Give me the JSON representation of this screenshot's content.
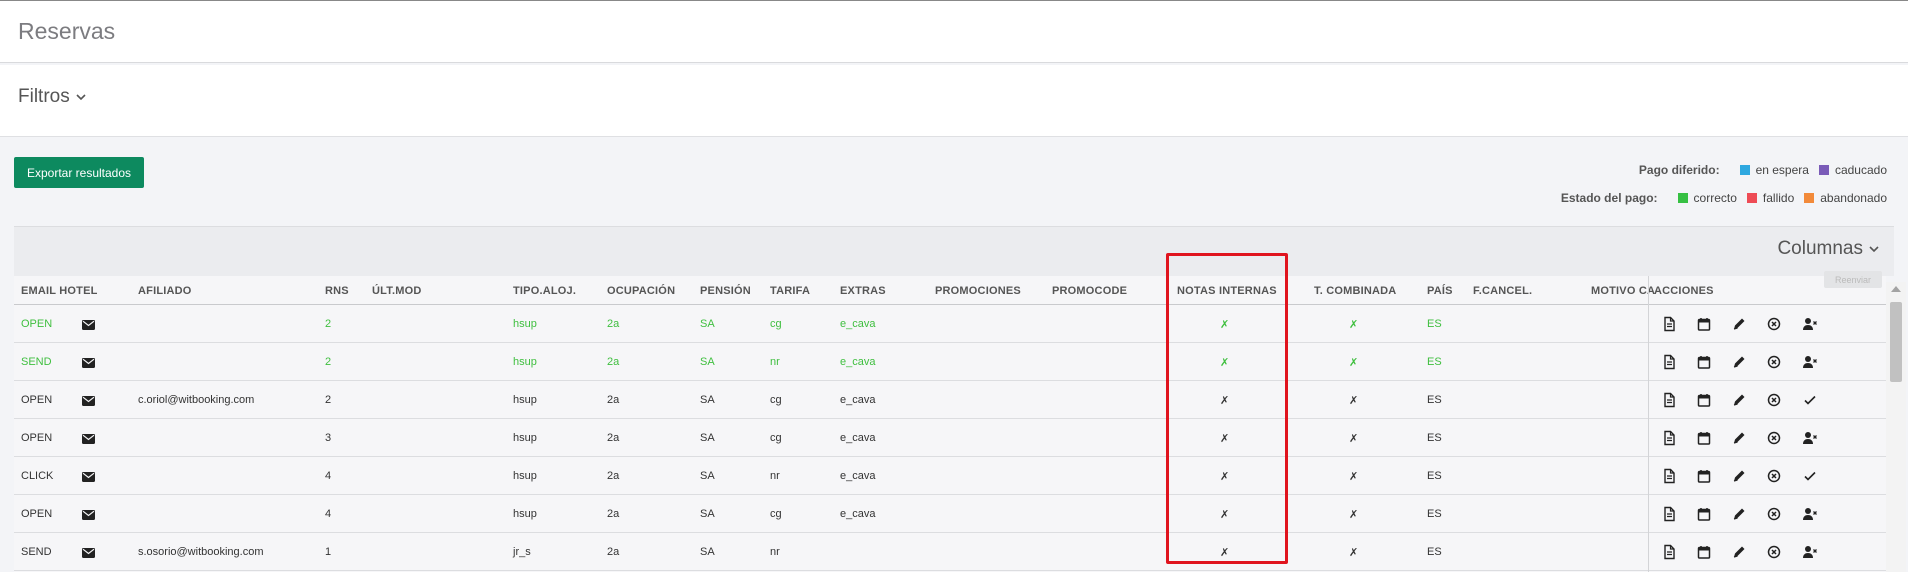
{
  "page": {
    "title": "Reservas"
  },
  "filters": {
    "label": "Filtros"
  },
  "toolbar": {
    "export_label": "Exportar resultados"
  },
  "legend": {
    "deferred_payment": {
      "title": "Pago diferido:",
      "items": [
        {
          "label": "en espera",
          "color": "#2ea8e0"
        },
        {
          "label": "caducado",
          "color": "#7a5bb8"
        }
      ]
    },
    "payment_status": {
      "title": "Estado del pago:",
      "items": [
        {
          "label": "correcto",
          "color": "#36c043"
        },
        {
          "label": "fallido",
          "color": "#ee4b55"
        },
        {
          "label": "abandonado",
          "color": "#f28a3a"
        }
      ]
    }
  },
  "columns_panel": {
    "label": "Columnas"
  },
  "tooltip": {
    "text": "Reenviar"
  },
  "table": {
    "headers": {
      "email": "EMAIL HOTEL",
      "afiliado": "AFILIADO",
      "rns": "RNS",
      "ultmod": "ÚLT.MOD",
      "tipo": "TIPO.ALOJ.",
      "ocupacion": "OCUPACIÓN",
      "pension": "PENSIÓN",
      "tarifa": "TARIFA",
      "extras": "EXTRAS",
      "promociones": "PROMOCIONES",
      "promocode": "PROMOCODE",
      "notas": "NOTAS INTERNAS",
      "combinada": "T. COMBINADA",
      "pais": "PAÍS",
      "fcancel": "F.CANCEL.",
      "motivo": "MOTIVO CA",
      "acciones": "ACCIONES"
    },
    "rows": [
      {
        "email_status": "OPEN",
        "afiliado": "",
        "rns": "2",
        "tipo": "hsup",
        "ocupacion": "2a",
        "pension": "SA",
        "tarifa": "cg",
        "extras": "e_cava",
        "notas": "✗",
        "combinada": "✗",
        "pais": "ES",
        "last_action": "user-remove-icon"
      },
      {
        "email_status": "SEND",
        "afiliado": "",
        "rns": "2",
        "tipo": "hsup",
        "ocupacion": "2a",
        "pension": "SA",
        "tarifa": "nr",
        "extras": "e_cava",
        "notas": "✗",
        "combinada": "✗",
        "pais": "ES",
        "last_action": "user-remove-icon"
      },
      {
        "email_status": "OPEN",
        "afiliado": "c.oriol@witbooking.com",
        "rns": "2",
        "tipo": "hsup",
        "ocupacion": "2a",
        "pension": "SA",
        "tarifa": "cg",
        "extras": "e_cava",
        "notas": "✗",
        "combinada": "✗",
        "pais": "ES",
        "last_action": "check-icon"
      },
      {
        "email_status": "OPEN",
        "afiliado": "",
        "rns": "3",
        "tipo": "hsup",
        "ocupacion": "2a",
        "pension": "SA",
        "tarifa": "cg",
        "extras": "e_cava",
        "notas": "✗",
        "combinada": "✗",
        "pais": "ES",
        "last_action": "user-remove-icon"
      },
      {
        "email_status": "CLICK",
        "afiliado": "",
        "rns": "4",
        "tipo": "hsup",
        "ocupacion": "2a",
        "pension": "SA",
        "tarifa": "nr",
        "extras": "e_cava",
        "notas": "✗",
        "combinada": "✗",
        "pais": "ES",
        "last_action": "check-icon"
      },
      {
        "email_status": "OPEN",
        "afiliado": "",
        "rns": "4",
        "tipo": "hsup",
        "ocupacion": "2a",
        "pension": "SA",
        "tarifa": "cg",
        "extras": "e_cava",
        "notas": "✗",
        "combinada": "✗",
        "pais": "ES",
        "last_action": "user-remove-icon"
      },
      {
        "email_status": "SEND",
        "afiliado": "s.osorio@witbooking.com",
        "rns": "1",
        "tipo": "jr_s",
        "ocupacion": "2a",
        "pension": "SA",
        "tarifa": "nr",
        "extras": "",
        "notas": "✗",
        "combinada": "✗",
        "pais": "ES",
        "last_action": "user-remove-icon"
      }
    ],
    "highlighted_rows": [
      0,
      1
    ]
  }
}
